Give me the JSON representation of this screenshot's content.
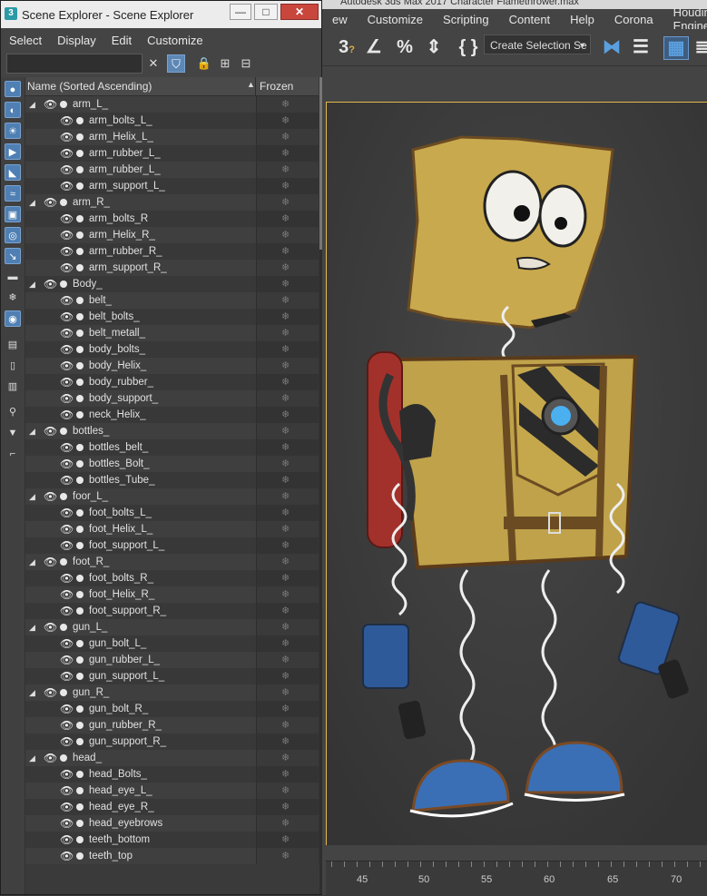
{
  "max_window": {
    "title": "Autodesk 3ds Max 2017    Character Flamethrower.max",
    "menu": [
      "ew",
      "Customize",
      "Scripting",
      "Content",
      "Help",
      "Corona",
      "Houdini Engine"
    ],
    "create_selection_set": "Create Selection Se",
    "timeline_labels": [
      "45",
      "50",
      "55",
      "60",
      "65",
      "70"
    ]
  },
  "scene_explorer": {
    "app_icon": "3",
    "title": "Scene Explorer - Scene Explorer",
    "menu": [
      "Select",
      "Display",
      "Edit",
      "Customize"
    ],
    "search_value": "",
    "columns": {
      "name": "Name (Sorted Ascending)",
      "frozen": "Frozen"
    },
    "rows": [
      {
        "name": "arm_L_",
        "level": 0
      },
      {
        "name": "arm_bolts_L_",
        "level": 1
      },
      {
        "name": "arm_Helix_L_",
        "level": 1
      },
      {
        "name": "arm_rubber_L_",
        "level": 1
      },
      {
        "name": "arm_rubber_L_",
        "level": 1
      },
      {
        "name": "arm_support_L_",
        "level": 1
      },
      {
        "name": "arm_R_",
        "level": 0
      },
      {
        "name": "arm_bolts_R",
        "level": 1
      },
      {
        "name": "arm_Helix_R_",
        "level": 1
      },
      {
        "name": "arm_rubber_R_",
        "level": 1
      },
      {
        "name": "arm_support_R_",
        "level": 1
      },
      {
        "name": "Body_",
        "level": 0
      },
      {
        "name": "belt_",
        "level": 1
      },
      {
        "name": "belt_bolts_",
        "level": 1
      },
      {
        "name": "belt_metall_",
        "level": 1
      },
      {
        "name": "body_bolts_",
        "level": 1
      },
      {
        "name": "body_Helix_",
        "level": 1
      },
      {
        "name": "body_rubber_",
        "level": 1
      },
      {
        "name": "body_support_",
        "level": 1
      },
      {
        "name": "neck_Helix_",
        "level": 1
      },
      {
        "name": "bottles_",
        "level": 0
      },
      {
        "name": "bottles_belt_",
        "level": 1
      },
      {
        "name": "bottles_Bolt_",
        "level": 1
      },
      {
        "name": "bottles_Tube_",
        "level": 1
      },
      {
        "name": "foor_L_",
        "level": 0
      },
      {
        "name": "foot_bolts_L_",
        "level": 1
      },
      {
        "name": "foot_Helix_L_",
        "level": 1
      },
      {
        "name": "foot_support_L_",
        "level": 1
      },
      {
        "name": "foot_R_",
        "level": 0
      },
      {
        "name": "foot_bolts_R_",
        "level": 1
      },
      {
        "name": "foot_Helix_R_",
        "level": 1
      },
      {
        "name": "foot_support_R_",
        "level": 1
      },
      {
        "name": "gun_L_",
        "level": 0
      },
      {
        "name": "gun_bolt_L_",
        "level": 1
      },
      {
        "name": "gun_rubber_L_",
        "level": 1
      },
      {
        "name": "gun_support_L_",
        "level": 1
      },
      {
        "name": "gun_R_",
        "level": 0
      },
      {
        "name": "gun_bolt_R_",
        "level": 1
      },
      {
        "name": "gun_rubber_R_",
        "level": 1
      },
      {
        "name": "gun_support_R_",
        "level": 1
      },
      {
        "name": "head_",
        "level": 0
      },
      {
        "name": "head_Bolts_",
        "level": 1
      },
      {
        "name": "head_eye_L_",
        "level": 1
      },
      {
        "name": "head_eye_R_",
        "level": 1
      },
      {
        "name": "head_eyebrows",
        "level": 1
      },
      {
        "name": "teeth_bottom",
        "level": 1
      },
      {
        "name": "teeth_top",
        "level": 1
      }
    ]
  },
  "colors": {
    "viewport_border": "#e3b94a",
    "active_blue": "#5d87b5",
    "close_red": "#c9463d"
  }
}
